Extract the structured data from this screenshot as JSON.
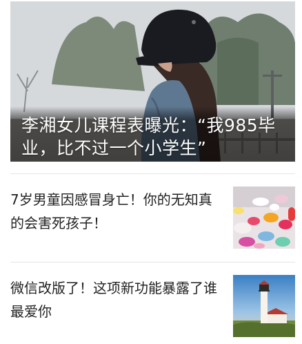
{
  "feed": {
    "hero": {
      "title": "李湘女儿课程表曝光：“我985毕业，比不过一个小学生”"
    },
    "items": [
      {
        "title": "7岁男童因感冒身亡！你的无知真的会害死孩子！"
      },
      {
        "title": "微信改版了！这项新功能暴露了谁最爱你"
      }
    ]
  }
}
